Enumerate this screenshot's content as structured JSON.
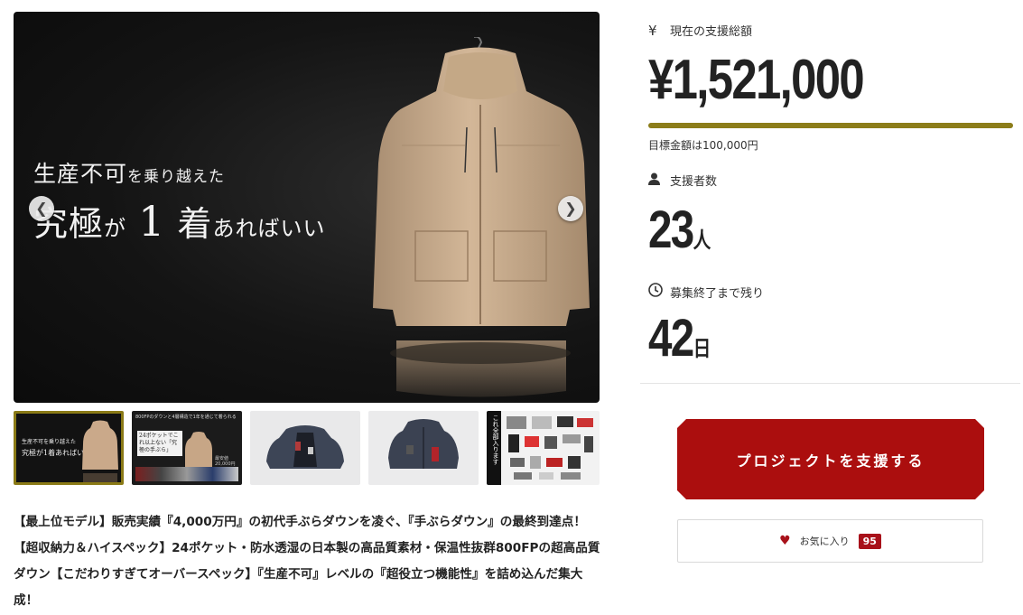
{
  "hero": {
    "line1_main": "生産不可",
    "line1_rest": "を乗り越えた",
    "line2_a": "究極",
    "line2_b": "が",
    "line2_num": "1",
    "line2_c": "着",
    "line2_d": "あればいい",
    "prev_icon": "chevron-left-icon",
    "next_icon": "chevron-right-icon"
  },
  "thumbnails": [
    {
      "name": "thumb-1",
      "active": true,
      "text_a": "生産不可を乗り越えた",
      "text_b": "究極が1着あればいい"
    },
    {
      "name": "thumb-2",
      "active": false,
      "text_a": "800FPのダウンと4層構造で1年を通じて着られる",
      "text_b": "24ポケットでこれ以上ない「究極の手ぶら」",
      "text_c": "最安値20,000円"
    },
    {
      "name": "thumb-3",
      "active": false
    },
    {
      "name": "thumb-4",
      "active": false
    },
    {
      "name": "thumb-5",
      "active": false,
      "text_a": "これ全部入ります"
    }
  ],
  "description": "【最上位モデル】販売実績『4,000万円』の初代手ぶらダウンを凌ぐ、『手ぶらダウン』の最終到達点！【超収納力＆ハイスペック】24ポケット・防水透湿の日本製の高品質素材・保温性抜群800FPの超高品質ダウン【こだわりすぎてオーバースペック】『生産不可』レベルの『超役立つ機能性』を詰め込んだ集大成！",
  "funding": {
    "icon": "yen-icon",
    "label": "現在の支援総額",
    "amount": "¥1,521,000",
    "progress_fraction": 1.0,
    "goal_text": "目標金額は100,000円"
  },
  "supporters": {
    "icon": "person-icon",
    "label": "支援者数",
    "count": "23",
    "unit": "人"
  },
  "remaining": {
    "icon": "clock-icon",
    "label": "募集終了まで残り",
    "count": "42",
    "unit": "日"
  },
  "actions": {
    "support_label": "プロジェクトを支援する",
    "favorite_label": "お気に入り",
    "favorite_count": "95"
  },
  "colors": {
    "accent_gold": "#8c7d1a",
    "button_red": "#ab0e0e",
    "badge_red": "#a8111a"
  }
}
